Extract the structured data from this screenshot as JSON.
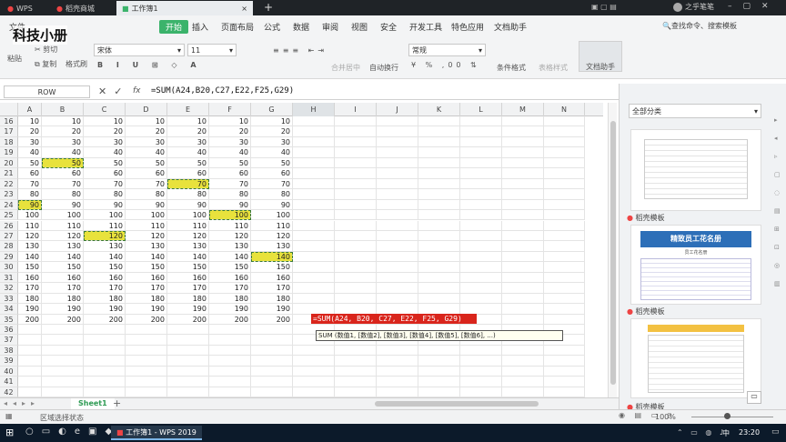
{
  "tabs": [
    "WPS",
    "稻壳商城",
    "工作簿1"
  ],
  "watermark": "科技小册",
  "menu": [
    "文件",
    "开始",
    "插入",
    "页面布局",
    "公式",
    "数据",
    "审阅",
    "视图",
    "安全",
    "开发工具",
    "特色应用",
    "文档助手"
  ],
  "search_hint": "查找命令、搜索模板",
  "user": "之乎笔笔",
  "ribbon": {
    "cut": "剪切",
    "copy": "复制",
    "paste": "粘贴",
    "format_painter": "格式刷",
    "font_name": "宋体",
    "font_size": "11",
    "merge": "合并居中",
    "wrap": "自动换行",
    "number_format": "常规",
    "cond_format": "条件格式",
    "table_style": "表格样式",
    "doc_helper": "文档助手"
  },
  "formula_bar": {
    "name_box": "ROW",
    "fx": "fx",
    "formula": "=SUM(A24,B20,C27,E22,F25,G29)"
  },
  "columns": [
    "A",
    "B",
    "C",
    "D",
    "E",
    "F",
    "G",
    "H",
    "I",
    "J",
    "K",
    "L",
    "M",
    "N"
  ],
  "rows": [
    {
      "n": "16",
      "v": [
        "10",
        "10",
        "10",
        "10",
        "10",
        "10",
        "10"
      ]
    },
    {
      "n": "17",
      "v": [
        "20",
        "20",
        "20",
        "20",
        "20",
        "20",
        "20"
      ]
    },
    {
      "n": "18",
      "v": [
        "30",
        "30",
        "30",
        "30",
        "30",
        "30",
        "30"
      ]
    },
    {
      "n": "19",
      "v": [
        "40",
        "40",
        "40",
        "40",
        "40",
        "40",
        "40"
      ]
    },
    {
      "n": "20",
      "v": [
        "50",
        "50",
        "50",
        "50",
        "50",
        "50",
        "50"
      ]
    },
    {
      "n": "21",
      "v": [
        "60",
        "60",
        "60",
        "60",
        "60",
        "60",
        "60"
      ]
    },
    {
      "n": "22",
      "v": [
        "70",
        "70",
        "70",
        "70",
        "70",
        "70",
        "70"
      ]
    },
    {
      "n": "23",
      "v": [
        "80",
        "80",
        "80",
        "80",
        "80",
        "80",
        "80"
      ]
    },
    {
      "n": "24",
      "v": [
        "90",
        "90",
        "90",
        "90",
        "90",
        "90",
        "90"
      ]
    },
    {
      "n": "25",
      "v": [
        "100",
        "100",
        "100",
        "100",
        "100",
        "100",
        "100"
      ]
    },
    {
      "n": "26",
      "v": [
        "110",
        "110",
        "110",
        "110",
        "110",
        "110",
        "110"
      ]
    },
    {
      "n": "27",
      "v": [
        "120",
        "120",
        "120",
        "120",
        "120",
        "120",
        "120"
      ]
    },
    {
      "n": "28",
      "v": [
        "130",
        "130",
        "130",
        "130",
        "130",
        "130",
        "130"
      ]
    },
    {
      "n": "29",
      "v": [
        "140",
        "140",
        "140",
        "140",
        "140",
        "140",
        "140"
      ]
    },
    {
      "n": "30",
      "v": [
        "150",
        "150",
        "150",
        "150",
        "150",
        "150",
        "150"
      ]
    },
    {
      "n": "31",
      "v": [
        "160",
        "160",
        "160",
        "160",
        "160",
        "160",
        "160"
      ]
    },
    {
      "n": "32",
      "v": [
        "170",
        "170",
        "170",
        "170",
        "170",
        "170",
        "170"
      ]
    },
    {
      "n": "33",
      "v": [
        "180",
        "180",
        "180",
        "180",
        "180",
        "180",
        "180"
      ]
    },
    {
      "n": "34",
      "v": [
        "190",
        "190",
        "190",
        "190",
        "190",
        "190",
        "190"
      ]
    },
    {
      "n": "35",
      "v": [
        "200",
        "200",
        "200",
        "200",
        "200",
        "200",
        "200"
      ]
    },
    {
      "n": "36",
      "v": [
        "",
        "",
        "",
        "",
        "",
        "",
        ""
      ]
    },
    {
      "n": "37",
      "v": [
        "",
        "",
        "",
        "",
        "",
        "",
        ""
      ]
    },
    {
      "n": "38",
      "v": [
        "",
        "",
        "",
        "",
        "",
        "",
        ""
      ]
    },
    {
      "n": "39",
      "v": [
        "",
        "",
        "",
        "",
        "",
        "",
        ""
      ]
    },
    {
      "n": "40",
      "v": [
        "",
        "",
        "",
        "",
        "",
        "",
        ""
      ]
    },
    {
      "n": "41",
      "v": [
        "",
        "",
        "",
        "",
        "",
        "",
        ""
      ]
    },
    {
      "n": "42",
      "v": [
        "",
        "",
        "",
        "",
        "",
        "",
        ""
      ]
    }
  ],
  "highlighted_cells": [
    "A24",
    "B20",
    "C27",
    "E22",
    "F25",
    "G29"
  ],
  "active_cell_formula": "=SUM(A24, B20, C27, E22, F25, G29)",
  "tooltip": "SUM (数值1, [数值2], [数值3], [数值4], [数值5], [数值6], ...)",
  "sheet_tab": "Sheet1",
  "status_text": "区域选择状态",
  "taskpane": {
    "dropdown": "全部分类",
    "section1": "稻壳模板",
    "section2": "稻壳模板",
    "section3": "稻壳模板",
    "template2_title": "精致员工花名册",
    "template2_sub": "员工花名册"
  },
  "zoom": "100%",
  "taskbar": {
    "app_label": "工作簿1 - WPS 2019",
    "time": "23:20",
    "ime": "中"
  },
  "colors": {
    "accent": "#3bb36b",
    "highlight": "#e8e23c",
    "formula_red": "#d9251c",
    "sheet_tab": "#2e9b53"
  }
}
